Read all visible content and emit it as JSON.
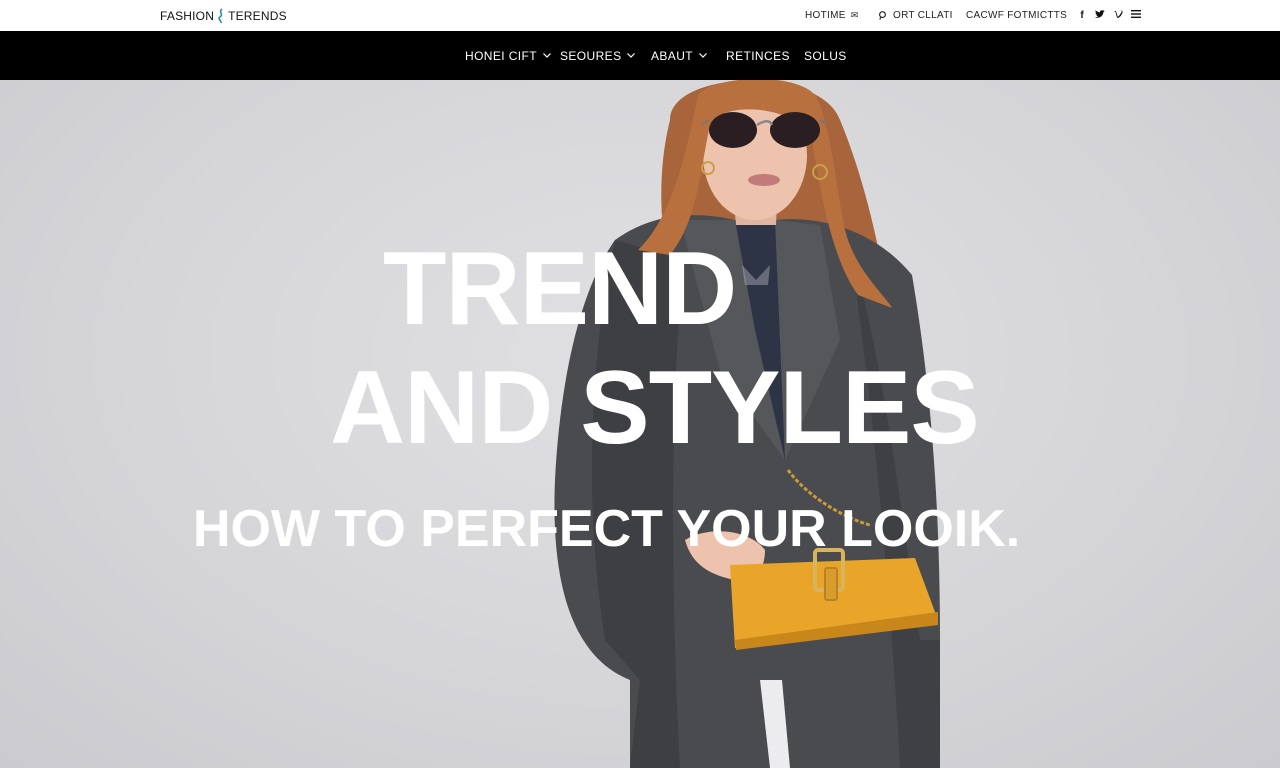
{
  "brand": {
    "left": "FASHION",
    "right": "TERENDS"
  },
  "utility": {
    "home": "HOTIME",
    "contact": "ORT CLLATI",
    "shop": "CACWF FOTMICTTS"
  },
  "social_icons": [
    "facebook-icon",
    "twitter-icon",
    "vimeo-icon",
    "menu-icon"
  ],
  "nav": {
    "items": [
      {
        "label": "HONEI CIFT",
        "has_dropdown": true
      },
      {
        "label": "SEOURES",
        "has_dropdown": true
      },
      {
        "label": "ABAUT",
        "has_dropdown": true
      },
      {
        "label": "RETINCES",
        "has_dropdown": false
      },
      {
        "label": "SOLUS",
        "has_dropdown": false
      }
    ]
  },
  "hero": {
    "line1": "TREND",
    "line2": "AND STYLES",
    "line3": "HOW TO PERFECT YOUR LOOIK."
  },
  "colors": {
    "navbar_bg": "#000000",
    "topbar_bg": "#ffffff",
    "hero_bg": "#d7d7da",
    "hero_text": "#ffffff",
    "accent_bag": "#e8a52a",
    "coat": "#4a4b4e"
  }
}
